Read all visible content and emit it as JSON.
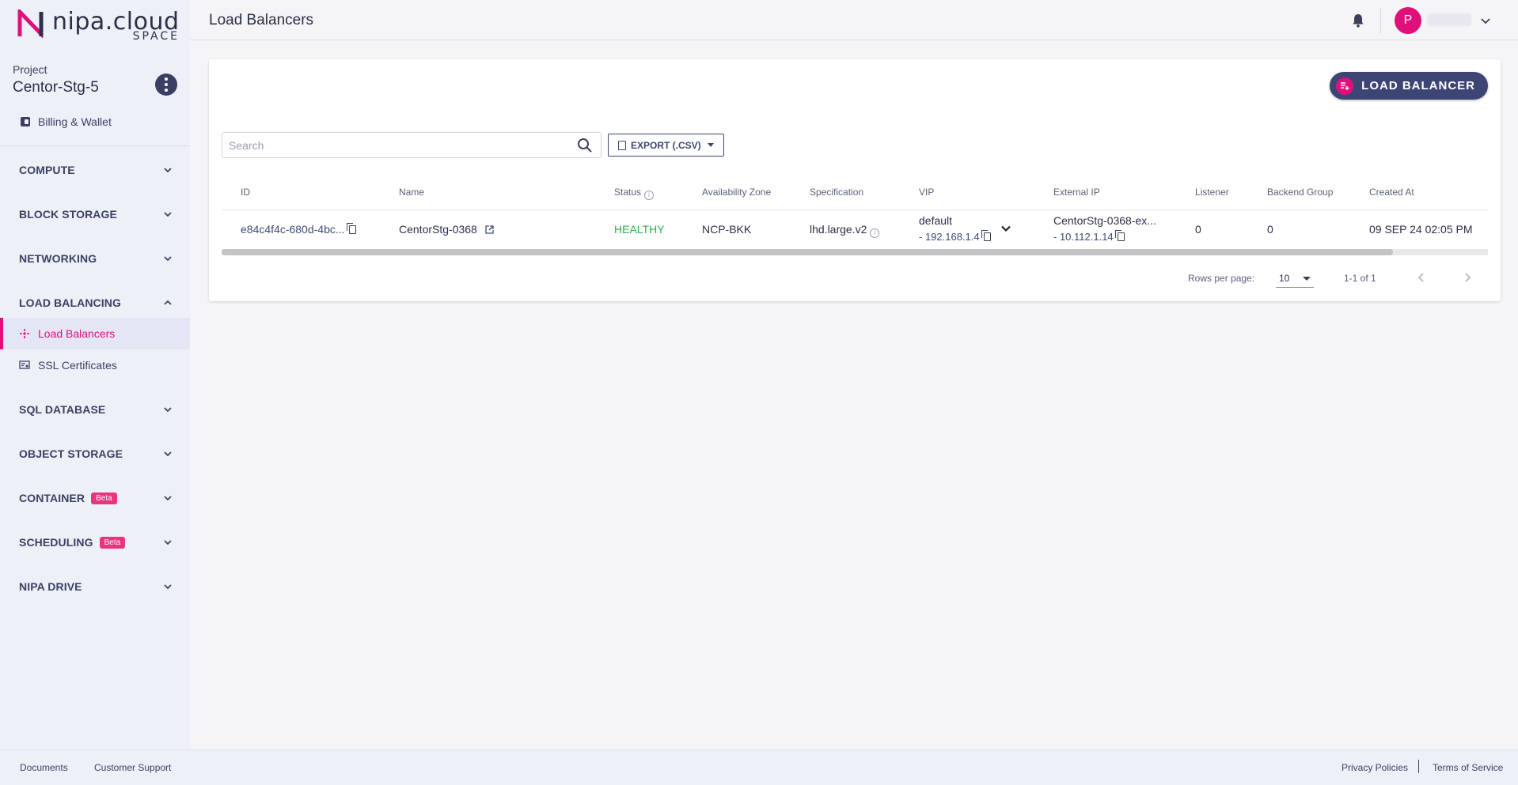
{
  "brand": {
    "name": "nipa.cloud",
    "sub": "SPACE",
    "accent": "#e0107a"
  },
  "project": {
    "label": "Project",
    "name": "Centor-Stg-5"
  },
  "sidebar": {
    "billing": "Billing & Wallet",
    "sections": [
      {
        "label": "COMPUTE",
        "expanded": false
      },
      {
        "label": "BLOCK STORAGE",
        "expanded": false
      },
      {
        "label": "NETWORKING",
        "expanded": false
      },
      {
        "label": "LOAD BALANCING",
        "expanded": true
      },
      {
        "label": "SQL DATABASE",
        "expanded": false
      },
      {
        "label": "OBJECT STORAGE",
        "expanded": false
      },
      {
        "label": "CONTAINER",
        "badge": "Beta",
        "expanded": false
      },
      {
        "label": "SCHEDULING",
        "badge": "Beta",
        "expanded": false
      },
      {
        "label": "NIPA DRIVE",
        "expanded": false
      }
    ],
    "lb_items": [
      {
        "label": "Load Balancers",
        "active": true
      },
      {
        "label": "SSL Certificates",
        "active": false
      }
    ]
  },
  "header": {
    "title": "Load Balancers",
    "avatar_initial": "P"
  },
  "toolbar": {
    "add_label": "LOAD BALANCER",
    "search_placeholder": "Search",
    "export_label": "EXPORT (.CSV)"
  },
  "table": {
    "columns": [
      "ID",
      "Name",
      "Status",
      "Availability Zone",
      "Specification",
      "VIP",
      "External IP",
      "Listener",
      "Backend Group",
      "Created At"
    ],
    "rows": [
      {
        "id": "e84c4f4c-680d-4bc...",
        "name": "CentorStg-0368",
        "status": "HEALTHY",
        "zone": "NCP-BKK",
        "spec": "lhd.large.v2",
        "vip_name": "default",
        "vip_ip": "- 192.168.1.4",
        "ext_name": "CentorStg-0368-ex...",
        "ext_ip": "- 10.112.1.14",
        "listener": "0",
        "backend": "0",
        "created": "09 SEP 24 02:05 PM"
      }
    ]
  },
  "pagination": {
    "rows_label": "Rows per page:",
    "rows_value": "10",
    "range": "1-1 of 1"
  },
  "footer": {
    "documents": "Documents",
    "support": "Customer Support",
    "privacy": "Privacy Policies",
    "terms": "Terms of Service"
  }
}
